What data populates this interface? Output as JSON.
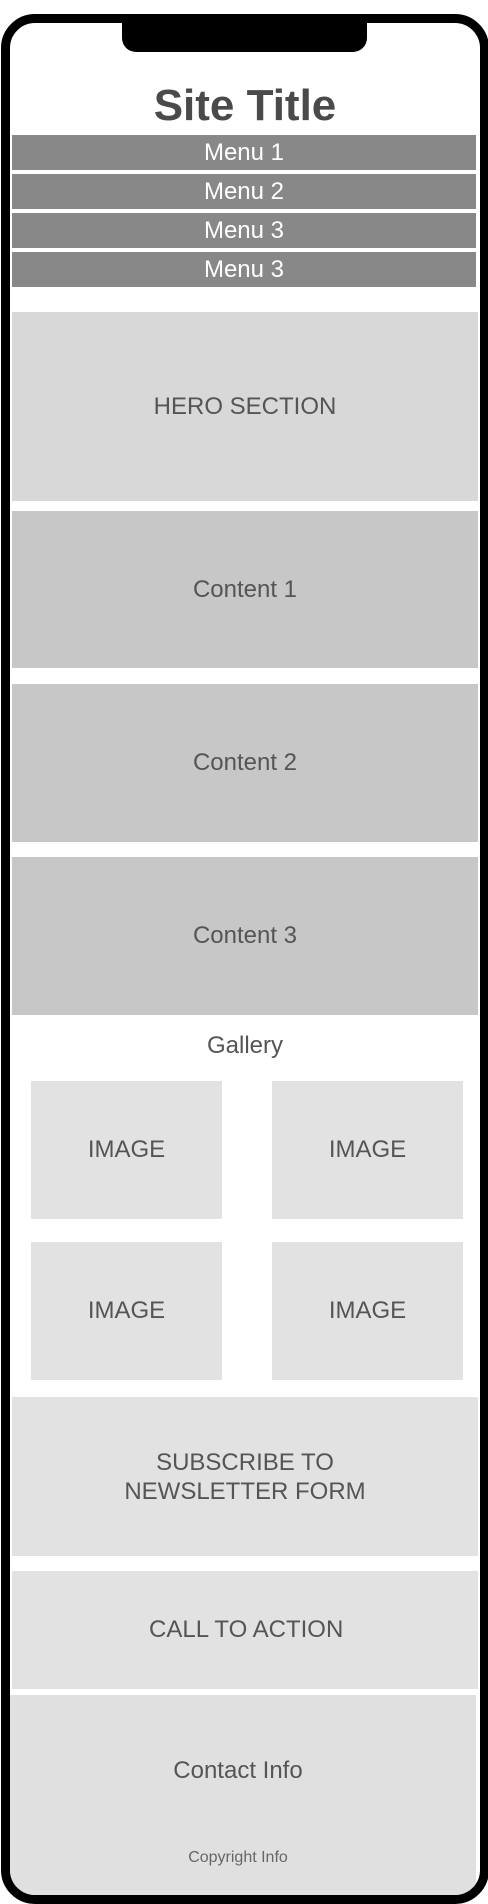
{
  "site": {
    "title": "Site Title"
  },
  "menu": [
    "Menu 1",
    "Menu 2",
    "Menu 3",
    "Menu 3"
  ],
  "hero": {
    "label": "HERO SECTION"
  },
  "content": [
    "Content 1",
    "Content 2",
    "Content 3"
  ],
  "gallery": {
    "title": "Gallery",
    "images": [
      "IMAGE",
      "IMAGE",
      "IMAGE",
      "IMAGE"
    ]
  },
  "newsletter": {
    "line1": "SUBSCRIBE TO",
    "line2": "NEWSLETTER FORM"
  },
  "cta": {
    "label": "CALL TO ACTION"
  },
  "footer": {
    "contact": "Contact Info",
    "copyright": "Copyright Info"
  },
  "colors": {
    "menu_bg": "#888888",
    "hero_bg": "#d8d8d8",
    "content_bg": "#c7c7c7",
    "light_bg": "#e2e2e2",
    "frame": "#000000"
  }
}
